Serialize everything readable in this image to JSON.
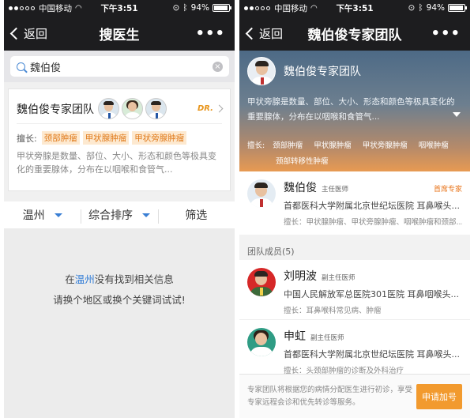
{
  "status_bar": {
    "carrier": "中国移动",
    "time": "下午3:51",
    "battery": "94%",
    "battery_level": 0.94
  },
  "left": {
    "nav": {
      "back_label": "返回",
      "title": "搜医生",
      "more_label": "•••"
    },
    "search": {
      "value": "魏伯俊",
      "placeholder": ""
    },
    "team_card": {
      "name": "魏伯俊专家团队",
      "logo_text": "DR.",
      "specialty_label": "擅长:",
      "tags": [
        "颈部肿瘤",
        "甲状腺肿瘤",
        "甲状旁腺肿瘤"
      ],
      "description": "甲状旁腺是数量、部位、大小、形态和颜色等极具变化的重要腺体，分布在以咽喉和食管气..."
    },
    "filters": [
      {
        "label": "温州"
      },
      {
        "label": "综合排序"
      },
      {
        "label": "筛选"
      }
    ],
    "empty": {
      "prefix": "在",
      "city": "温州",
      "suffix": "没有找到相关信息",
      "line2": "请换个地区或换个关键词试试!"
    }
  },
  "right": {
    "nav": {
      "back_label": "返回",
      "title": "魏伯俊专家团队",
      "more_label": "•••"
    },
    "hero": {
      "title": "魏伯俊专家团队",
      "description": "甲状旁腺是数量、部位、大小、形态和颜色等极具变化的重要腺体，分布在以咽喉和食管气...",
      "skills_label": "擅长:",
      "skills": [
        "颈部肿瘤",
        "甲状腺肿瘤",
        "甲状旁腺肿瘤",
        "咽喉肿瘤",
        "颈部转移性肿瘤"
      ]
    },
    "lead": {
      "name": "魏伯俊",
      "title": "主任医师",
      "badge": "首席专家",
      "hospital": "首都医科大学附属北京世纪坛医院 耳鼻喉头...",
      "specialty": "擅长：甲状腺肿瘤、甲状旁腺肿瘤、咽喉肿瘤和颈部..."
    },
    "members_header": "团队成员(5)",
    "members": [
      {
        "name": "刘明波",
        "title": "副主任医师",
        "hospital": "中国人民解放军总医院301医院 耳鼻咽喉头...",
        "specialty": "擅长：耳鼻喉科常见病、肿瘤"
      },
      {
        "name": "申虹",
        "title": "副主任医师",
        "hospital": "首都医科大学附属北京世纪坛医院 耳鼻喉头...",
        "specialty": "擅长：头颈部肿瘤的诊断及外科治疗"
      }
    ],
    "bottom": {
      "info": "专家团队将根据您的病情分配医生进行初诊，享受专家远程会诊和优先转诊等服务。",
      "apply_label": "申请加号"
    }
  }
}
